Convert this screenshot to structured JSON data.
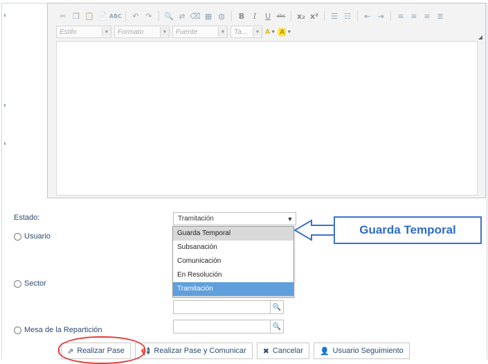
{
  "editor": {
    "toolbar_icons": [
      "cut-icon",
      "copy-icon",
      "paste-icon",
      "paste-text-icon",
      "spellcheck-icon",
      "undo-icon",
      "redo-icon",
      "find-icon",
      "replace-icon",
      "eraser-icon",
      "select-all-icon",
      "globe-icon",
      "bold-icon",
      "italic-icon",
      "underline-icon",
      "strikethrough-icon",
      "subscript-icon",
      "superscript-icon",
      "numbered-list-icon",
      "bullet-list-icon",
      "outdent-icon",
      "indent-icon",
      "align-left-icon",
      "align-center-icon",
      "align-right-icon",
      "justify-icon"
    ],
    "bold": "B",
    "italic": "I",
    "underline": "U",
    "strike": "abc",
    "sub": "x₂",
    "sup": "x²",
    "style_combo": "Estilo",
    "format_combo": "Formato",
    "font_combo": "Fuente",
    "size_combo": "Ta...",
    "text_color": "A",
    "bg_color": "A"
  },
  "form": {
    "estado_label": "Estado:",
    "estado_value": "Tramitación",
    "options": [
      "Guarda Temporal",
      "Subsanación",
      "Comunicación",
      "En Resolución",
      "Tramitación"
    ],
    "hovered_option": "Guarda Temporal",
    "selected_option": "Tramitación",
    "usuario_label": "Usuario",
    "sector_label": "Sector",
    "mesa_label": "Mesa de la Repartición"
  },
  "callout": {
    "text": "Guarda Temporal",
    "border_color": "#3a73c7",
    "text_color": "#2f6cc6"
  },
  "buttons": {
    "realizar_pase": "Realizar Pase",
    "realizar_pase_comunicar": "Realizar Pase y Comunicar",
    "cancelar": "Cancelar",
    "usuario_seguimiento": "Usuario Seguimiento"
  },
  "highlight_color": "#e23c3c",
  "selected_color": "#5fa0dc"
}
